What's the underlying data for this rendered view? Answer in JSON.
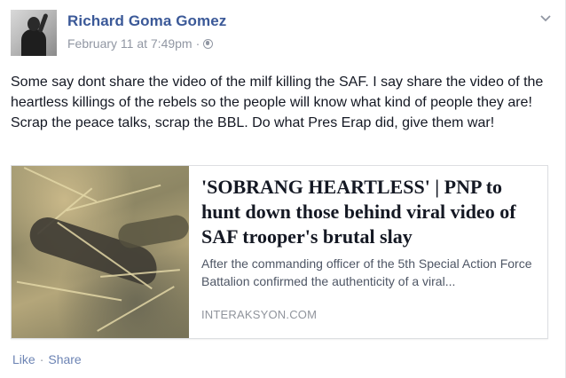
{
  "post": {
    "author": "Richard Goma Gomez",
    "date": "February 11 at 7:49pm",
    "separator": "·",
    "privacy_icon": "globe-icon",
    "menu_icon": "chevron-down-icon",
    "text_lines": [
      "Some say dont share the video of the milf killing the SAF. I say share the video of the heartless killings of the rebels so the people will know what kind of people they are!",
      "Scrap the peace talks, scrap the BBL. Do what Pres Erap did, give them war!"
    ],
    "link_card": {
      "title": "'SOBRANG HEARTLESS' | PNP to hunt down those behind viral video of SAF trooper's brutal slay",
      "description": "After the commanding officer of the 5th Special Action Force Battalion confirmed the authenticity of a viral...",
      "domain": "INTERAKSYON.COM"
    },
    "actions": {
      "like": "Like",
      "separator": "·",
      "share": "Share"
    }
  },
  "colors": {
    "author_link": "#3b5998",
    "meta_gray": "#9197a3",
    "action_link": "#6d84b4",
    "text": "#141823"
  }
}
